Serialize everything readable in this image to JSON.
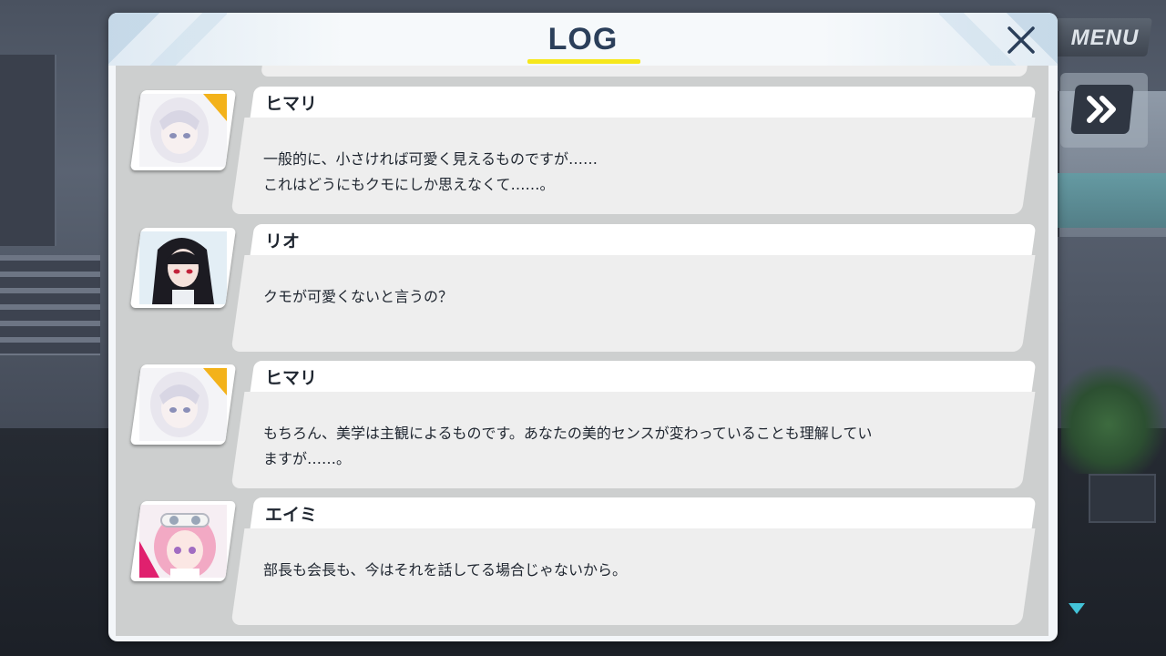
{
  "hud": {
    "menu_label": "MENU",
    "fast_forward_icon": "double-chevron-right-icon",
    "scroll_indicator_icon": "triangle-down-icon"
  },
  "log": {
    "title": "LOG",
    "close_icon": "close-icon",
    "entries": [
      {
        "speaker": "ヒマリ",
        "portrait": "himari-portrait",
        "lines": [
          "一般的に、小さければ可愛く見えるものですが……",
          "これはどうにもクモにしか思えなくて……。"
        ]
      },
      {
        "speaker": "リオ",
        "portrait": "rio-portrait",
        "lines": [
          "クモが可愛くないと言うの？"
        ]
      },
      {
        "speaker": "ヒマリ",
        "portrait": "himari-portrait",
        "lines": [
          "もちろん、美学は主観によるものです。あなたの美的センスが変わっていることも理解してい",
          "ますが……。"
        ]
      },
      {
        "speaker": "エイミ",
        "portrait": "eimi-portrait",
        "lines": [
          "部長も会長も、今はそれを話してる場合じゃないから。"
        ]
      }
    ]
  },
  "colors": {
    "title_text": "#2b3f5a",
    "title_underline": "#f6e71b",
    "name_bar": "#ffffff",
    "message_box": "#eeeeee",
    "log_body": "#cdcfcf"
  }
}
